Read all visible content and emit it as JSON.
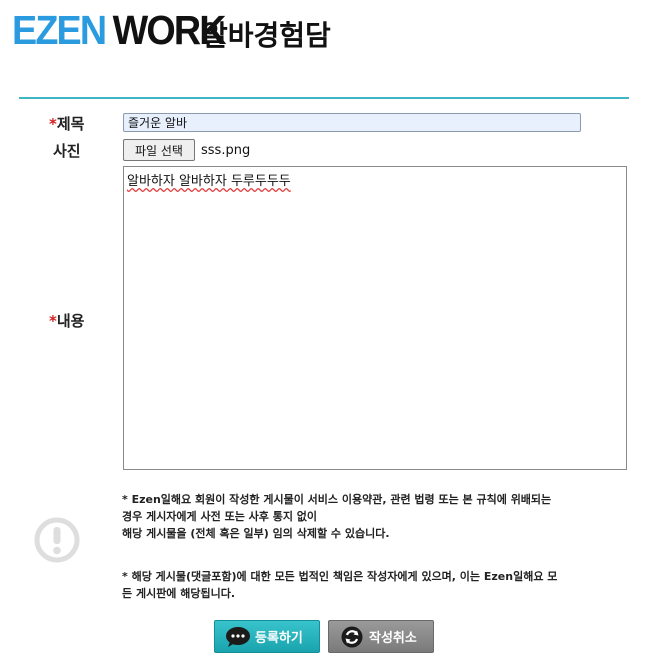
{
  "header": {
    "logo_part1": "EZEN",
    "logo_part2": "WORK",
    "title": "알바경험담"
  },
  "form": {
    "title_label": "제목",
    "title_value": "즐거운 알바",
    "photo_label": "사진",
    "file_button_label": "파일 선택",
    "file_name": "sss.png",
    "content_label": "내용",
    "content_value": "알바하자 알바하자 두루두두두",
    "required_mark": "*"
  },
  "notice": {
    "icon": "exclamation-circle-icon",
    "paragraph1": "* Ezen일해요 회원이 작성한 게시물이 서비스 이용약관, 관련 법령 또는 본 규칙에 위배되는\n경우 게시자에게 사전 또는 사후 통지 없이\n해당 게시물을 (전체 혹은 일부) 임의 삭제할 수 있습니다.",
    "paragraph2": "* 해당 게시물(댓글포함)에 대한 모든 법적인 책임은 작성자에게 있으며, 이는 Ezen일해요 모\n든 게시판에 해당됩니다."
  },
  "buttons": {
    "submit_label": "등록하기",
    "cancel_label": "작성취소",
    "submit_icon": "speech-bubble-icon",
    "cancel_icon": "refresh-icon"
  },
  "colors": {
    "accent": "#3fb6c2",
    "logo_blue": "#2b9be0",
    "required": "#d62020",
    "submit_button": "#1aa3ad",
    "cancel_button": "#7a7a7a"
  }
}
